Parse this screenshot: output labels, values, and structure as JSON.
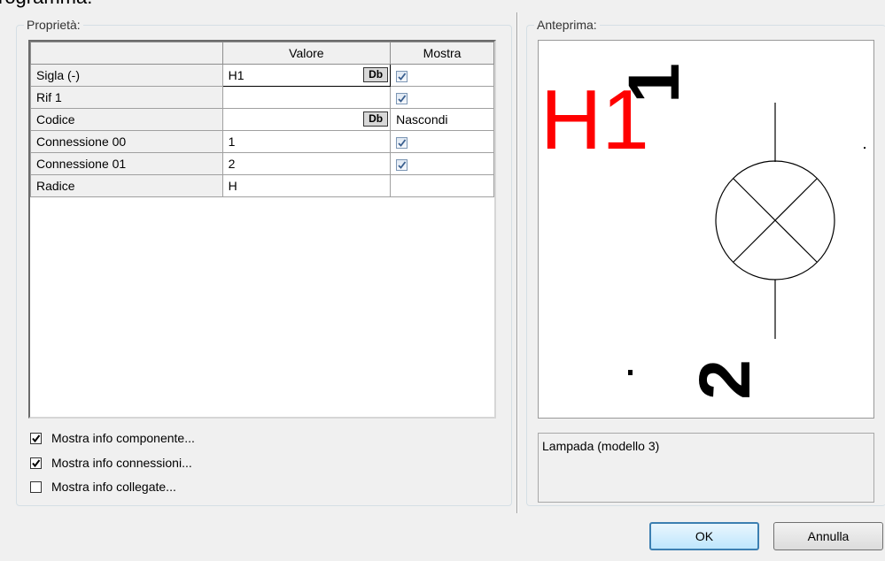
{
  "cut_title": "rogramma:",
  "properties_group": {
    "title": "Proprietà:",
    "columns": [
      "",
      "Valore",
      "Mostra"
    ],
    "rows": [
      {
        "name": "Sigla (-)",
        "value": "H1",
        "db": "Db",
        "show": "checked"
      },
      {
        "name": "Rif 1",
        "value": "",
        "db": "",
        "show": "checked"
      },
      {
        "name": "Codice",
        "value": "",
        "db": "Db",
        "show": "Nascondi"
      },
      {
        "name": "Connessione 00",
        "value": "1",
        "db": "",
        "show": "checked"
      },
      {
        "name": "Connessione 01",
        "value": "2",
        "db": "",
        "show": "checked"
      },
      {
        "name": "Radice",
        "value": "H",
        "db": "",
        "show": ""
      }
    ]
  },
  "options": [
    {
      "label": "Mostra info componente...",
      "checked": true
    },
    {
      "label": "Mostra info connessioni...",
      "checked": true
    },
    {
      "label": "Mostra info collegate...",
      "checked": false
    }
  ],
  "preview_group": {
    "title": "Anteprima:",
    "symbol_tag": "H1",
    "pin_top": "1",
    "pin_bottom": "2",
    "tag_color": "#ff0000",
    "description": "Lampada (modello 3)"
  },
  "buttons": {
    "ok": "OK",
    "cancel": "Annulla"
  }
}
